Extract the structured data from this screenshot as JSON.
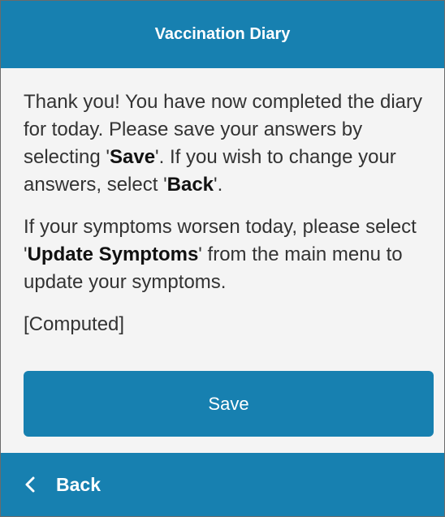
{
  "header": {
    "title": "Vaccination Diary"
  },
  "message": {
    "p1_part1": "Thank you! You have now completed the diary for today. Please save your answers by selecting '",
    "p1_save": "Save",
    "p1_part2": "'. If you wish to change your answers, select '",
    "p1_back": "Back",
    "p1_part3": "'.",
    "p2_part1": "If your symptoms worsen today, please select '",
    "p2_update": "Update Symptoms",
    "p2_part2": "' from the main menu to update your symptoms.",
    "computed": "[Computed]"
  },
  "actions": {
    "save_label": "Save"
  },
  "footer": {
    "back_label": "Back",
    "back_icon": "chevron-left-icon"
  },
  "colors": {
    "primary": "#1780b0",
    "background": "#f4f4f4",
    "text": "#333333"
  }
}
